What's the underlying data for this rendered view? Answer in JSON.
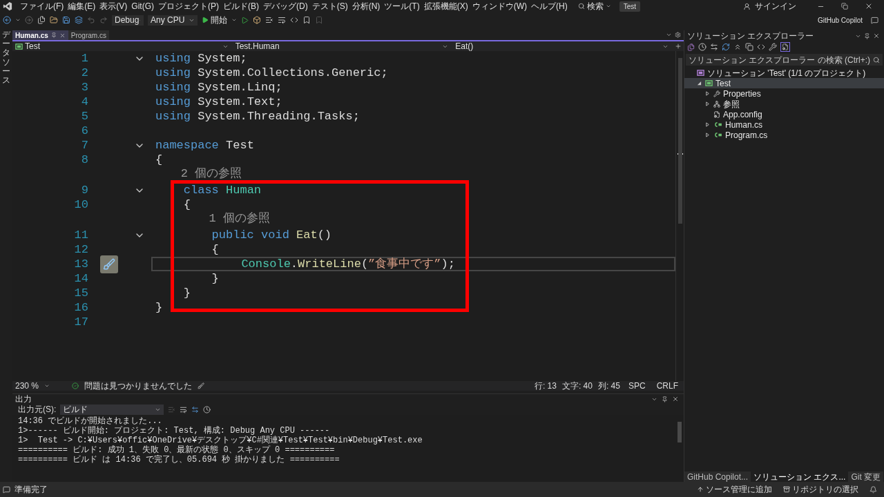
{
  "menu": {
    "items": [
      "ファイル(F)",
      "編集(E)",
      "表示(V)",
      "Git(G)",
      "プロジェクト(P)",
      "ビルド(B)",
      "デバッグ(D)",
      "テスト(S)",
      "分析(N)",
      "ツール(T)",
      "拡張機能(X)",
      "ウィンドウ(W)",
      "ヘルプ(H)"
    ],
    "search": "検索",
    "project": "Test",
    "sign_in": "サインイン"
  },
  "toolbar": {
    "configuration": "Debug",
    "platform": "Any CPU",
    "start": "開始",
    "copilot": "GitHub Copilot"
  },
  "side_strip": {
    "label": "データソース"
  },
  "tabs": [
    {
      "label": "Human.cs",
      "selected": true
    },
    {
      "label": "Program.cs",
      "selected": false
    }
  ],
  "nav_bar": {
    "project": "Test",
    "type": "Test.Human",
    "member": "Eat()"
  },
  "editor": {
    "lines": [
      {
        "kind": "code",
        "number": "1",
        "fold": true,
        "tokens": [
          {
            "kind": "keyword",
            "text": "using"
          },
          {
            "kind": "plain",
            "text": " System;"
          }
        ]
      },
      {
        "kind": "code",
        "number": "2",
        "fold": false,
        "tokens": [
          {
            "kind": "keyword",
            "text": "using"
          },
          {
            "kind": "plain",
            "text": " System.Collections.Generic;"
          }
        ]
      },
      {
        "kind": "code",
        "number": "3",
        "fold": false,
        "tokens": [
          {
            "kind": "keyword",
            "text": "using"
          },
          {
            "kind": "plain",
            "text": " System.Linq;"
          }
        ]
      },
      {
        "kind": "code",
        "number": "4",
        "fold": false,
        "tokens": [
          {
            "kind": "keyword",
            "text": "using"
          },
          {
            "kind": "plain",
            "text": " System.Text;"
          }
        ]
      },
      {
        "kind": "code",
        "number": "5",
        "fold": false,
        "tokens": [
          {
            "kind": "keyword",
            "text": "using"
          },
          {
            "kind": "plain",
            "text": " System.Threading.Tasks;"
          }
        ]
      },
      {
        "kind": "code",
        "number": "6",
        "fold": false
      },
      {
        "kind": "code",
        "number": "7",
        "fold": true,
        "tokens": [
          {
            "kind": "keyword",
            "text": "namespace"
          },
          {
            "kind": "plain",
            "text": " Test"
          }
        ]
      },
      {
        "kind": "code",
        "number": "8",
        "fold": false,
        "tokens": [
          {
            "kind": "plain",
            "text": "{"
          }
        ]
      },
      {
        "kind": "codelens",
        "text": "    2 個の参照"
      },
      {
        "kind": "code",
        "number": "9",
        "fold": true,
        "tokens": [
          {
            "kind": "keyword",
            "text": "    class"
          },
          {
            "kind": "type",
            "text": " Human"
          }
        ]
      },
      {
        "kind": "code",
        "number": "10",
        "fold": false,
        "tokens": [
          {
            "kind": "plain",
            "text": "    {"
          }
        ]
      },
      {
        "kind": "codelens",
        "text": "        1 個の参照"
      },
      {
        "kind": "code",
        "number": "11",
        "fold": true,
        "tokens": [
          {
            "kind": "keyword",
            "text": "        public void"
          },
          {
            "kind": "method",
            "text": " Eat"
          },
          {
            "kind": "plain",
            "text": "()"
          }
        ]
      },
      {
        "kind": "code",
        "number": "12",
        "fold": false,
        "tokens": [
          {
            "kind": "plain",
            "text": "        {"
          }
        ]
      },
      {
        "kind": "code",
        "number": "13",
        "fold": false,
        "current": true,
        "quick_action": true,
        "tokens": [
          {
            "kind": "type",
            "text": "            Console"
          },
          {
            "kind": "plain",
            "text": "."
          },
          {
            "kind": "method",
            "text": "WriteLine"
          },
          {
            "kind": "plain",
            "text": "("
          },
          {
            "kind": "string",
            "text": "”食事中です”"
          },
          {
            "kind": "plain",
            "text": ");"
          }
        ]
      },
      {
        "kind": "code",
        "number": "14",
        "fold": false,
        "tokens": [
          {
            "kind": "plain",
            "text": "        }"
          }
        ]
      },
      {
        "kind": "code",
        "number": "15",
        "fold": false,
        "tokens": [
          {
            "kind": "plain",
            "text": "    }"
          }
        ]
      },
      {
        "kind": "code",
        "number": "16",
        "fold": false,
        "tokens": [
          {
            "kind": "plain",
            "text": "}"
          }
        ]
      },
      {
        "kind": "code",
        "number": "17",
        "fold": false
      }
    ],
    "annotation": {
      "kind": "highlight-frame"
    }
  },
  "editor_status": {
    "zoom": "230 %",
    "issues": "問題は見つかりませんでした",
    "line": "行: 13",
    "char": "文字: 40",
    "column": "列: 45",
    "whitespace": "SPC",
    "line_ending": "CRLF"
  },
  "output": {
    "title": "出力",
    "source_label": "出力元(S):",
    "source": "ビルド",
    "lines": [
      "14:36 でビルドが開始されました...",
      "1>------ ビルド開始: プロジェクト: Test, 構成: Debug Any CPU ------",
      "1>  Test -> C:¥Users¥offic¥OneDrive¥デスクトップ¥C#関連¥Test¥Test¥bin¥Debug¥Test.exe",
      "========== ビルド: 成功 1、失敗 0、最新の状態 0、スキップ 0 ==========",
      "========== ビルド は 14:36 で完了し、05.694 秒 掛かりました =========="
    ]
  },
  "solution_explorer": {
    "title": "ソリューション エクスプローラー",
    "search_placeholder": "ソリューション エクスプローラー の検索 (Ctrl+:)",
    "tree": [
      {
        "label": "ソリューション 'Test' (1/1 のプロジェクト)",
        "kind": "solution",
        "selected": false,
        "children": [
          {
            "label": "Test",
            "kind": "project",
            "expanded": true,
            "selected": true,
            "children": [
              {
                "label": "Properties",
                "kind": "wrench",
                "expanded": false,
                "selected": false
              },
              {
                "label": "参照",
                "kind": "references",
                "expanded": false,
                "selected": false
              },
              {
                "label": "App.config",
                "kind": "config",
                "selected": false
              },
              {
                "label": "Human.cs",
                "kind": "csharp",
                "expanded": false,
                "selected": false
              },
              {
                "label": "Program.cs",
                "kind": "csharp",
                "expanded": false,
                "selected": false
              }
            ]
          }
        ]
      }
    ]
  },
  "panel_tabs": [
    {
      "label": "GitHub Copilot...",
      "selected": false
    },
    {
      "label": "ソリューション エクス...",
      "selected": true
    },
    {
      "label": "Git 変更",
      "selected": false
    }
  ],
  "status_bar": {
    "message": "準備完了",
    "source_control": "ソース管理に追加",
    "repository": "リポジトリの選択"
  }
}
